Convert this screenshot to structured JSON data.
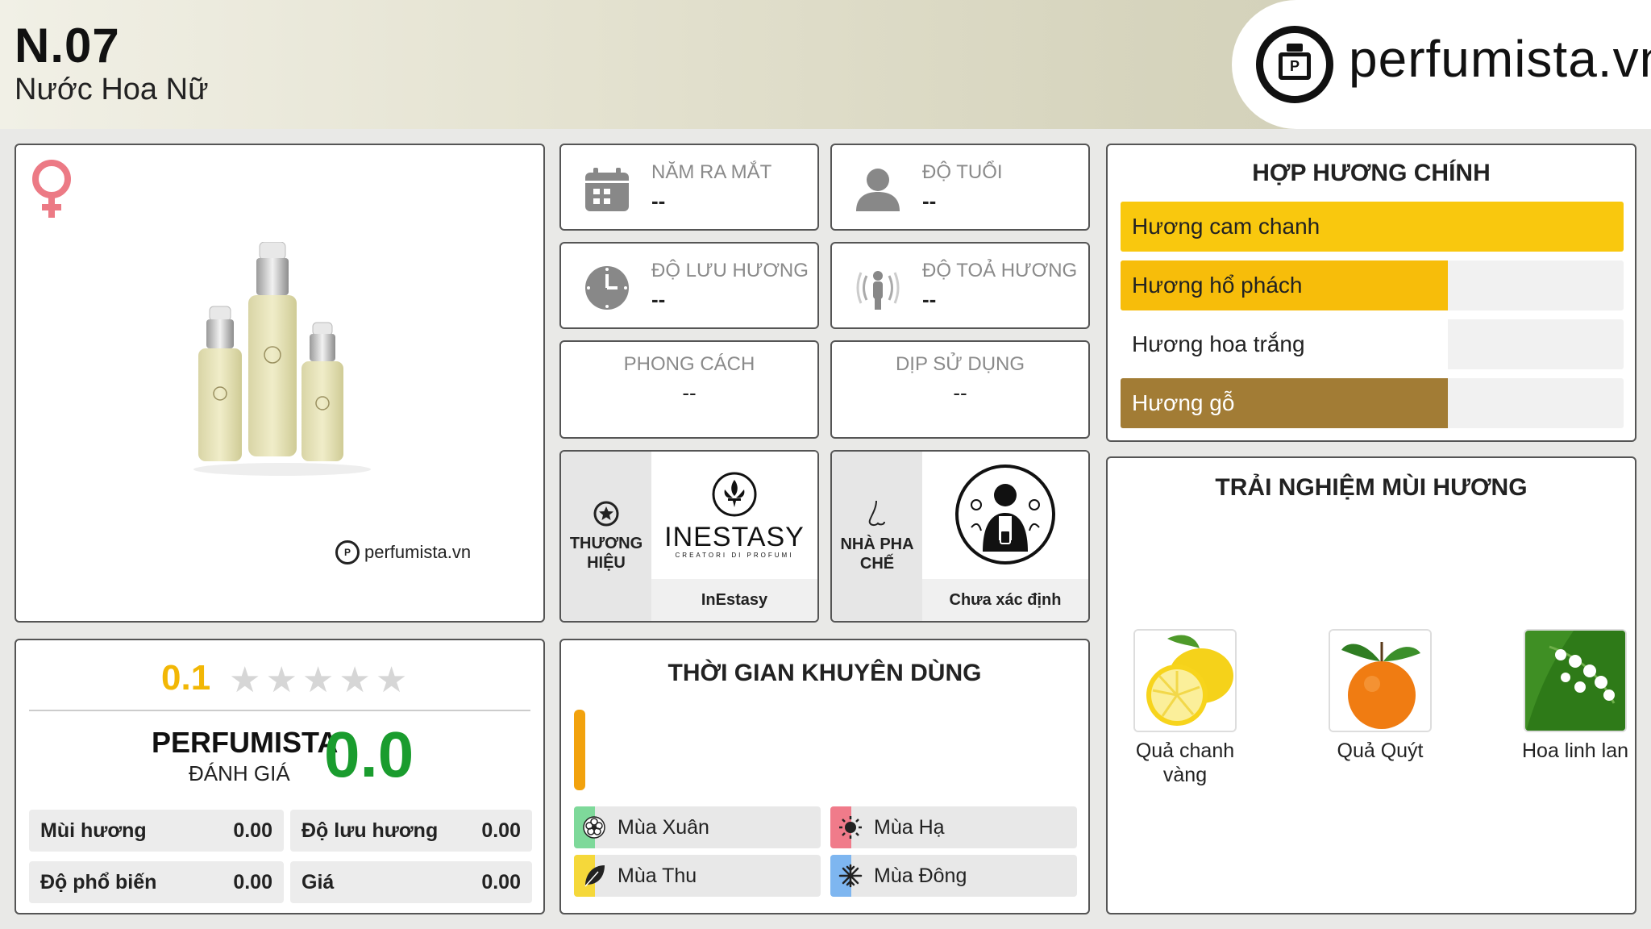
{
  "header": {
    "code": "N.07",
    "subtitle": "Nước Hoa Nữ",
    "logo_text": "perfumista.vn"
  },
  "product": {
    "gender_icon": "female-icon",
    "watermark": "perfumista.vn"
  },
  "info": {
    "release_year": {
      "label": "NĂM RA MẮT",
      "value": "--",
      "icon": "calendar-icon"
    },
    "age": {
      "label": "ĐỘ TUỔI",
      "value": "--",
      "icon": "person-icon"
    },
    "longevity": {
      "label": "ĐỘ LƯU HƯƠNG",
      "value": "--",
      "icon": "clock-icon"
    },
    "sillage": {
      "label": "ĐỘ TOẢ HƯƠNG",
      "value": "--",
      "icon": "sillage-icon"
    },
    "style": {
      "label": "PHONG CÁCH",
      "value": "--"
    },
    "occasion": {
      "label": "DỊP SỬ DỤNG",
      "value": "--"
    }
  },
  "brand": {
    "label": "THƯƠNG HIỆU",
    "logo_text": "INESTASY",
    "logo_subtext": "CREATORI DI PROFUMI",
    "name": "InEstasy",
    "icon": "star-badge-icon"
  },
  "perfumer": {
    "label": "NHÀ PHA CHẾ",
    "name": "Chưa xác định",
    "icon": "nose-icon"
  },
  "accords": {
    "title": "HỢP HƯƠNG CHÍNH",
    "items": [
      {
        "label": "Hương cam chanh",
        "level": 1.0,
        "color": "#f9c80e"
      },
      {
        "label": "Hương hổ phách",
        "level": 0.65,
        "color": "#f7bd0a"
      },
      {
        "label": "Hương hoa trắng",
        "level": 0.65,
        "color": "#ffffff"
      },
      {
        "label": "Hương gỗ",
        "level": 0.65,
        "color": "#a27c35"
      }
    ]
  },
  "experience": {
    "title": "TRẢI NGHIỆM MÙI HƯƠNG",
    "items": [
      {
        "name": "Quả chanh vàng",
        "icon": "lemon-image"
      },
      {
        "name": "Quả Quýt",
        "icon": "tangerine-image"
      },
      {
        "name": "Hoa linh lan",
        "icon": "lily-of-the-valley-image"
      }
    ]
  },
  "rating": {
    "score": "0.1",
    "stars_filled": 0,
    "stars_total": 5,
    "perfumista_label": "PERFUMISTA",
    "perfumista_sub": "ĐÁNH GIÁ",
    "perfumista_score": "0.0",
    "metrics": [
      {
        "label": "Mùi hương",
        "value": "0.00"
      },
      {
        "label": "Độ lưu hương",
        "value": "0.00"
      },
      {
        "label": "Độ phổ biến",
        "value": "0.00"
      },
      {
        "label": "Giá",
        "value": "0.00"
      }
    ]
  },
  "seasons": {
    "title": "THỜI GIAN KHUYÊN DÙNG",
    "time_bar_color": "#f2a20d",
    "items": [
      {
        "label": "Mùa Xuân",
        "color": "#7ed99a",
        "icon": "flower-icon"
      },
      {
        "label": "Mùa Hạ",
        "color": "#f07b8a",
        "icon": "sun-icon"
      },
      {
        "label": "Mùa Thu",
        "color": "#f5d83a",
        "icon": "leaf-icon"
      },
      {
        "label": "Mùa Đông",
        "color": "#7eb6f0",
        "icon": "snowflake-icon"
      }
    ]
  }
}
